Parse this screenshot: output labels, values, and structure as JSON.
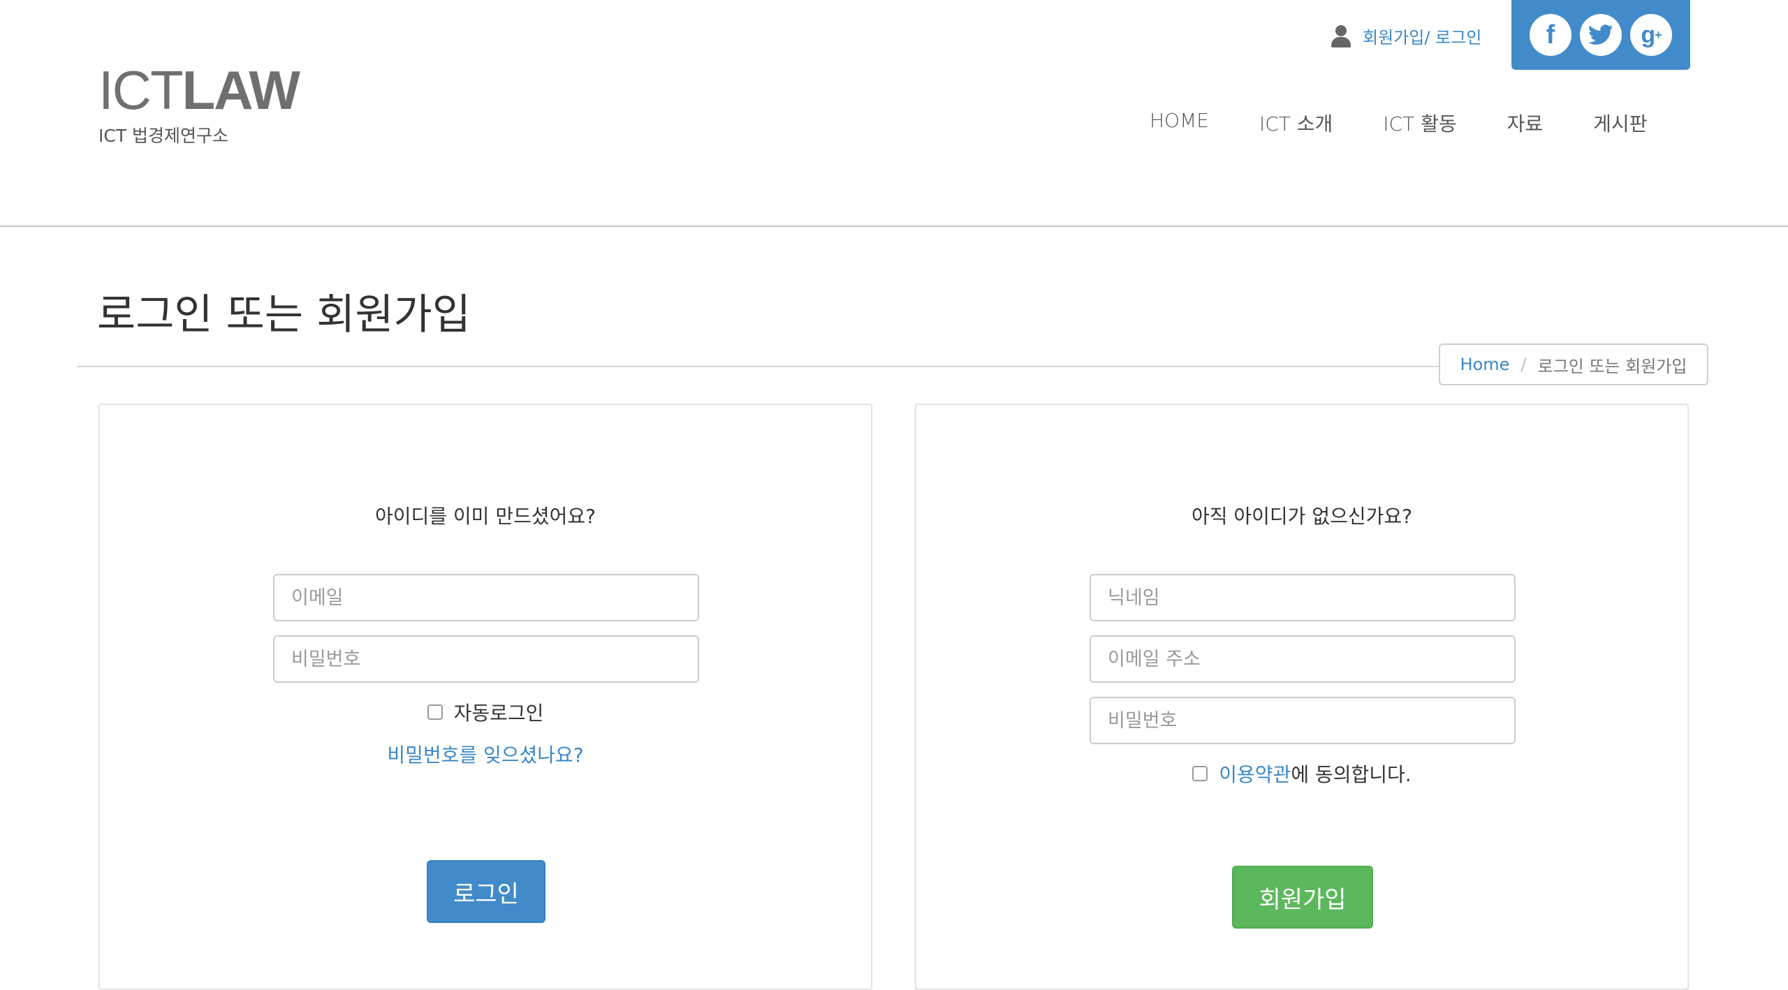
{
  "header": {
    "logo_light": "ICT",
    "logo_bold": "LAW",
    "logo_subtitle": "ICT 법경제연구소",
    "member_link": "회원가입/ 로그인",
    "social": {
      "facebook": "f",
      "googleplus": "g",
      "googleplus_sup": "+"
    },
    "nav": [
      "HOME",
      "ICT 소개",
      "ICT 활동",
      "자료",
      "게시판"
    ]
  },
  "page": {
    "title": "로그인 또는 회원가입",
    "breadcrumb": {
      "home": "Home",
      "separator": "/",
      "current": "로그인 또는 회원가입"
    }
  },
  "login": {
    "heading": "아이디를 이미 만드셨어요?",
    "email_placeholder": "이메일",
    "email_value": "",
    "password_placeholder": "비밀번호",
    "password_value": "",
    "remember_label": "자동로그인",
    "remember_checked": false,
    "forgot_link": "비밀번호를 잊으셨나요?",
    "submit_label": "로그인"
  },
  "signup": {
    "heading": "아직 아이디가 없으신가요?",
    "nickname_placeholder": "닉네임",
    "email_placeholder": "이메일 주소",
    "password_placeholder": "비밀번호",
    "terms_link": "이용약관",
    "terms_suffix": "에 동의합니다.",
    "terms_checked": false,
    "submit_label": "회원가입"
  },
  "colors": {
    "primary": "#428bca",
    "success": "#5cb85c",
    "link": "#3a87c8",
    "logo": "#6f6f6f"
  }
}
